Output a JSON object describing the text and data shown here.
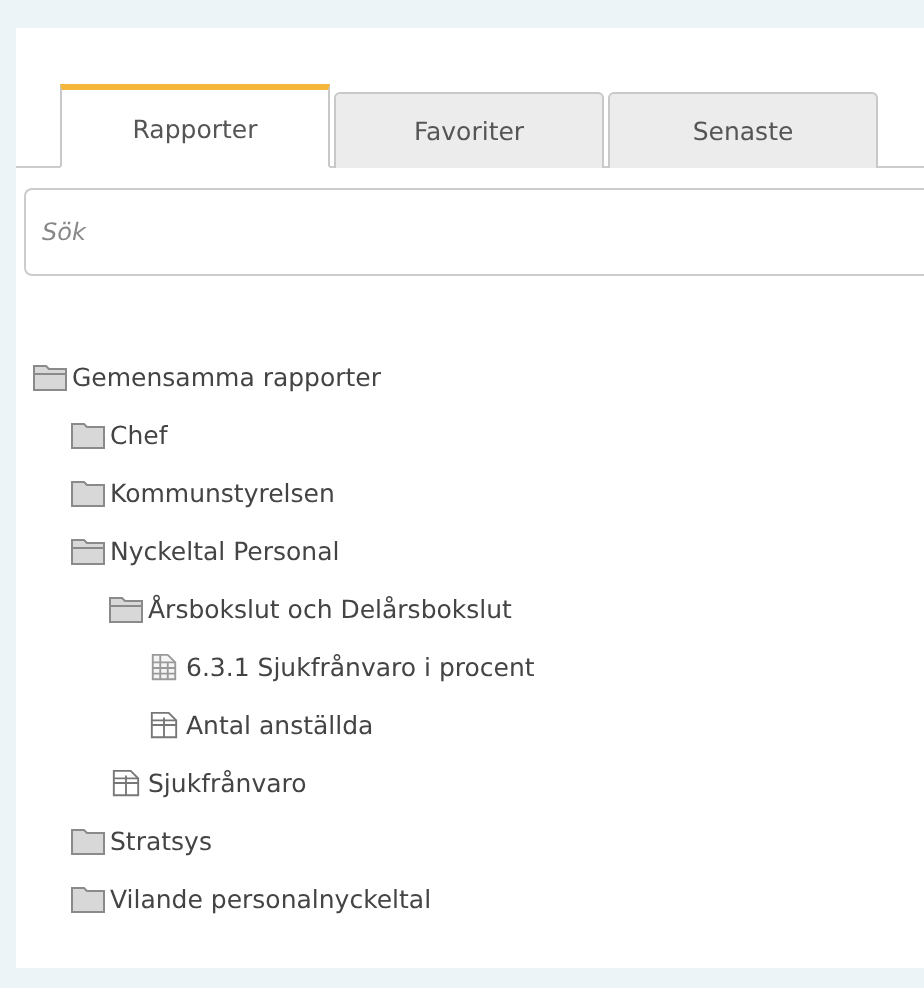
{
  "tabs": [
    {
      "label": "Rapporter",
      "selected": true
    },
    {
      "label": "Favoriter",
      "selected": false
    },
    {
      "label": "Senaste",
      "selected": false
    }
  ],
  "search": {
    "placeholder": "Sök"
  },
  "tree": [
    {
      "kind": "folder",
      "label": "Gemensamma rapporter",
      "expanded": true,
      "children": [
        {
          "kind": "folder",
          "label": "Chef",
          "expanded": false
        },
        {
          "kind": "folder",
          "label": "Kommunstyrelsen",
          "expanded": false
        },
        {
          "kind": "folder",
          "label": "Nyckeltal Personal",
          "expanded": true,
          "children": [
            {
              "kind": "folder",
              "label": "Årsbokslut och Delårsbokslut",
              "expanded": true,
              "children": [
                {
                  "kind": "grid",
                  "label": "6.3.1 Sjukfrånvaro i procent"
                },
                {
                  "kind": "crosstab",
                  "label": "Antal anställda"
                }
              ]
            },
            {
              "kind": "crosstab",
              "label": "Sjukfrånvaro"
            }
          ]
        },
        {
          "kind": "folder",
          "label": "Stratsys",
          "expanded": false
        },
        {
          "kind": "folder",
          "label": "Vilande personalnyckeltal",
          "expanded": false
        }
      ]
    }
  ]
}
